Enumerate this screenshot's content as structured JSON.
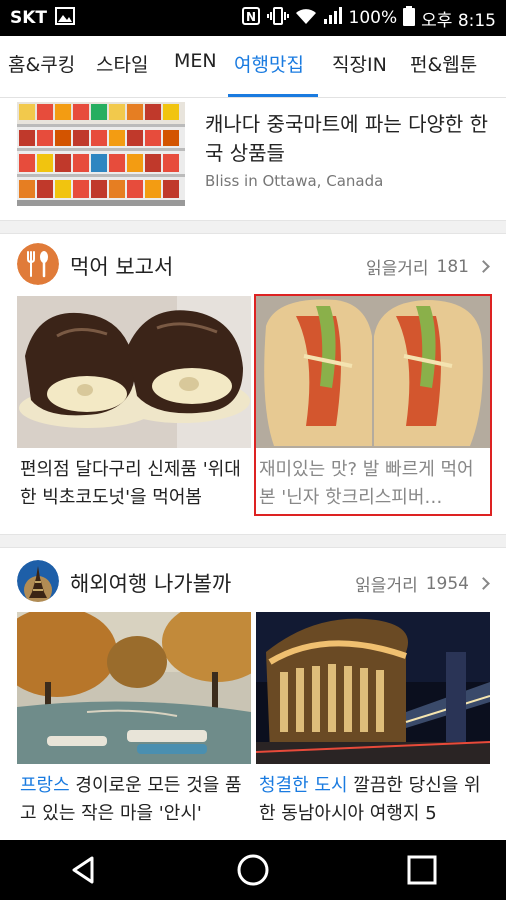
{
  "status_bar": {
    "carrier": "SKT",
    "battery": "100%",
    "time": "오후 8:15"
  },
  "tabs": [
    {
      "label": "홈&쿠킹"
    },
    {
      "label": "스타일"
    },
    {
      "label": "MEN"
    },
    {
      "label": "여행맛집",
      "active": true
    },
    {
      "label": "직장IN"
    },
    {
      "label": "펀&웹툰"
    }
  ],
  "top_article": {
    "title": "캐나다 중국마트에 파는 다양한 한국 상품들",
    "source": "Bliss in Ottawa, Canada"
  },
  "section1": {
    "title": "먹어 보고서",
    "count_label": "읽을거리",
    "count": "181",
    "cards": [
      {
        "title": "편의점 달다구리 신제품 '위대한 빅초코도넛'을 먹어봄"
      },
      {
        "title": "재미있는 맛? 발 빠르게 먹어 본 '닌자 핫크리스피버…"
      }
    ]
  },
  "section2": {
    "title": "해외여행 나가볼까",
    "count_label": "읽을거리",
    "count": "1954",
    "cards": [
      {
        "highlight": "프랑스",
        "title": " 경이로운 모든 것을 품고 있는 작은 마을 '안시'"
      },
      {
        "highlight": "청결한 도시",
        "title": " 깔끔한 당신을 위한 동남아시아 여행지 5"
      }
    ]
  },
  "colors": {
    "accent": "#1a7be0",
    "selected_border": "#dd2222"
  }
}
